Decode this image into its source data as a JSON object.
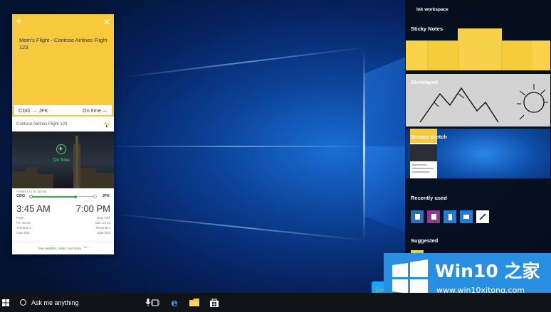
{
  "note": {
    "text": "Mom's Flight - Contoso Airlines Flight 123",
    "route": "CDG → JFK",
    "status": "On time",
    "airline_flight": "Contoso Airlines Flight 123",
    "photo_status": "On Time",
    "arrives": "Arrives in 1 hr 15 min",
    "origin": "CDG",
    "destination": "JFK",
    "progress_fraction": 0.7,
    "departure_time": "3:45 AM",
    "arrival_time": "7:00 PM",
    "departure_details": [
      "Paris",
      "Fri, Jul 14",
      "Terminal 4",
      "Gate B41"
    ],
    "arrival_details": [
      "New York",
      "Sat, Jul 15",
      "Terminal 4",
      "Gate B33"
    ],
    "footer": "See weather, maps, and more"
  },
  "ink": {
    "title": "Ink workspace",
    "sticky_notes": "Sticky Notes",
    "sketchpad": "Sketchpad",
    "screen_sketch": "Screen sketch",
    "recently_used": "Recently used",
    "suggested": "Suggested",
    "recent_apps": [
      {
        "name": "onenote-icon",
        "color": "#2f6fb8"
      },
      {
        "name": "onenote-purple-icon",
        "color": "#8a3a8f"
      },
      {
        "name": "bookmark-icon",
        "color": "#1f7bd3"
      },
      {
        "name": "photos-icon",
        "color": "#1f7bd3"
      },
      {
        "name": "pen-icon",
        "color": "#ffffff"
      }
    ]
  },
  "taskbar": {
    "search_placeholder": "Ask me anything"
  },
  "watermark": {
    "title": "Win10 之家",
    "url": "www.win10xitong.com"
  },
  "colors": {
    "note_yellow": "#f7c93d",
    "taskbar": "#101418",
    "watermark_blue": "#2a8fe0",
    "ontime_green": "#43d66b"
  }
}
